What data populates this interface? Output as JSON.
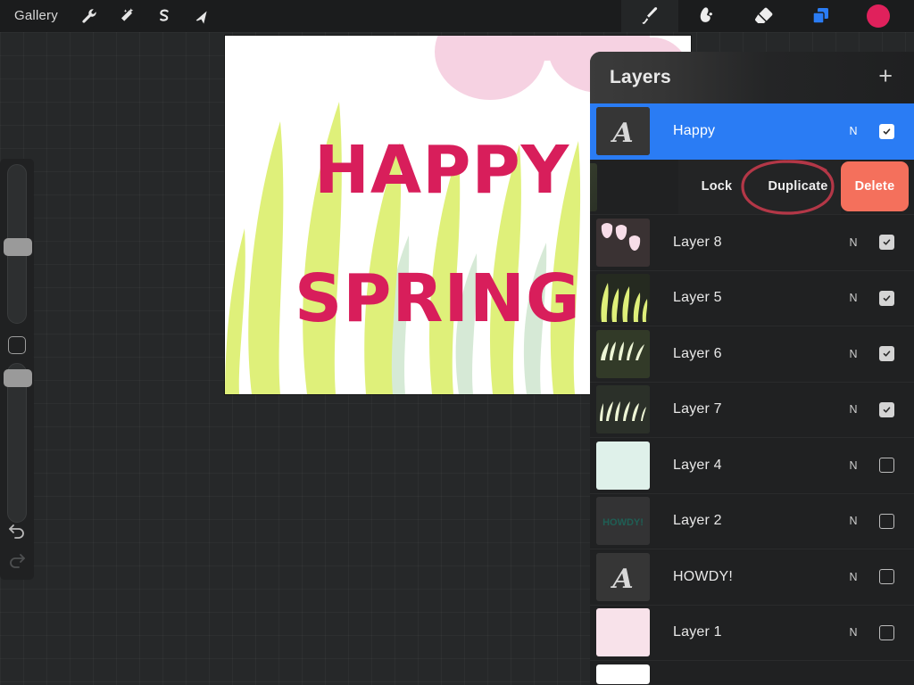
{
  "app": {
    "topbar": {
      "gallery_label": "Gallery",
      "tools": [
        {
          "name": "wrench-icon",
          "label": "Actions"
        },
        {
          "name": "magic-wand-icon",
          "label": "Adjustments"
        },
        {
          "name": "selection-s-icon",
          "label": "Selection"
        },
        {
          "name": "arrow-transform-icon",
          "label": "Transform"
        }
      ],
      "right_tools": [
        {
          "name": "brush-icon",
          "label": "Paint",
          "active": true
        },
        {
          "name": "smudge-icon",
          "label": "Smudge",
          "active": false
        },
        {
          "name": "eraser-icon",
          "label": "Erase",
          "active": false
        },
        {
          "name": "layers-icon",
          "label": "Layers",
          "active": false
        },
        {
          "name": "color-swatch",
          "label": "Color",
          "active": false
        }
      ],
      "layers_icon_color": "#2a7cf4",
      "color_swatch": "#e0215c"
    },
    "sidebar": {
      "brush_size_label": "Brush size",
      "modify_label": "Modify",
      "opacity_label": "Opacity",
      "undo_label": "Undo",
      "redo_label": "Redo"
    },
    "canvas": {
      "headline": "HAPPY",
      "subline": "SPRING",
      "text_color": "#d81e5b",
      "grass_color": "#dff07a",
      "grass_back_color": "#cfe6cf",
      "tulip_color": "#f6d2e2",
      "background": "#ffffff"
    },
    "layers_panel": {
      "title": "Layers",
      "add_label": "+",
      "swipe_actions": {
        "lock": "Lock",
        "duplicate": "Duplicate",
        "delete": "Delete",
        "blend": "N",
        "delete_color": "#f4705c",
        "annotation": "red-ellipse-around-duplicate"
      },
      "layers": [
        {
          "name": "Happy",
          "blend": "N",
          "visible": true,
          "selected": true,
          "thumb": "text-a"
        },
        {
          "name": "Layer 8",
          "blend": "N",
          "visible": true,
          "selected": false,
          "thumb": "tulips"
        },
        {
          "name": "Layer 5",
          "blend": "N",
          "visible": true,
          "selected": false,
          "thumb": "grass-bright"
        },
        {
          "name": "Layer 6",
          "blend": "N",
          "visible": true,
          "selected": false,
          "thumb": "grass-pale"
        },
        {
          "name": "Layer 7",
          "blend": "N",
          "visible": true,
          "selected": false,
          "thumb": "grass-pale2"
        },
        {
          "name": "Layer 4",
          "blend": "N",
          "visible": false,
          "selected": false,
          "thumb": "mint-fill"
        },
        {
          "name": "Layer 2",
          "blend": "N",
          "visible": false,
          "selected": false,
          "thumb": "howdy-text"
        },
        {
          "name": "HOWDY!",
          "blend": "N",
          "visible": false,
          "selected": false,
          "thumb": "text-a"
        },
        {
          "name": "Layer 1",
          "blend": "N",
          "visible": false,
          "selected": false,
          "thumb": "pink-fill"
        }
      ]
    }
  }
}
